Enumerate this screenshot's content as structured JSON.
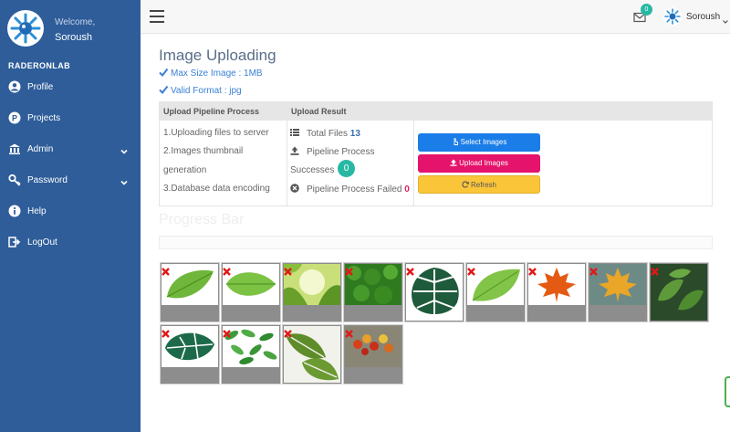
{
  "sidebar": {
    "welcome": "Welcome,",
    "username": "Soroush",
    "section_title": "RADERONLAB",
    "items": [
      {
        "label": "Profile",
        "icon": "user-circle-icon"
      },
      {
        "label": "Projects",
        "icon": "p-circle-icon"
      },
      {
        "label": "Admin",
        "icon": "bank-icon",
        "has_submenu": true
      },
      {
        "label": "Password",
        "icon": "key-icon",
        "has_submenu": true
      },
      {
        "label": "Help",
        "icon": "info-circle-icon"
      },
      {
        "label": "LogOut",
        "icon": "sign-out-icon"
      }
    ]
  },
  "topbar": {
    "mail_count": "0",
    "username": "Soroush"
  },
  "main": {
    "title": "Image Uploading",
    "max_size": "Max Size Image : 1MB",
    "valid_format": "Valid Format : jpg"
  },
  "pipeline": {
    "header_process": "Upload Pipeline Process",
    "header_result": "Upload Result",
    "steps": [
      "1.Uploading files to server",
      "2.Images thumbnail",
      "generation",
      "3.Database data encoding"
    ],
    "total_files_label": "Total Files",
    "total_files_value": "13",
    "pipeline_process_label": "Pipeline Process",
    "successes_label": "Successes",
    "successes_value": "0",
    "failed_label": "Pipeline Process Failed",
    "failed_value": "0"
  },
  "buttons": {
    "select": "Select Images",
    "upload": "Upload Images",
    "refresh": "Refresh"
  },
  "progress": {
    "title": "Progress Bar",
    "value": 0
  },
  "colors": {
    "sidebar": "#2e5d99",
    "accent_teal": "#27b8a4",
    "select_btn": "#1b7de8",
    "upload_btn": "#e5136c",
    "refresh_btn": "#fbc53a",
    "link_blue": "#3a7fd5"
  },
  "thumbnails": [
    {
      "name": "leaf-1"
    },
    {
      "name": "leaf-2"
    },
    {
      "name": "leaves-sunlight"
    },
    {
      "name": "green-hedge"
    },
    {
      "name": "monstera-leaves"
    },
    {
      "name": "green-leaf"
    },
    {
      "name": "maple-leaf-orange"
    },
    {
      "name": "maple-leaf-yellow"
    },
    {
      "name": "tea-leaves"
    },
    {
      "name": "monstera-leaf"
    },
    {
      "name": "scattered-leaves"
    },
    {
      "name": "monstera-plant"
    },
    {
      "name": "autumn-leaves"
    }
  ]
}
